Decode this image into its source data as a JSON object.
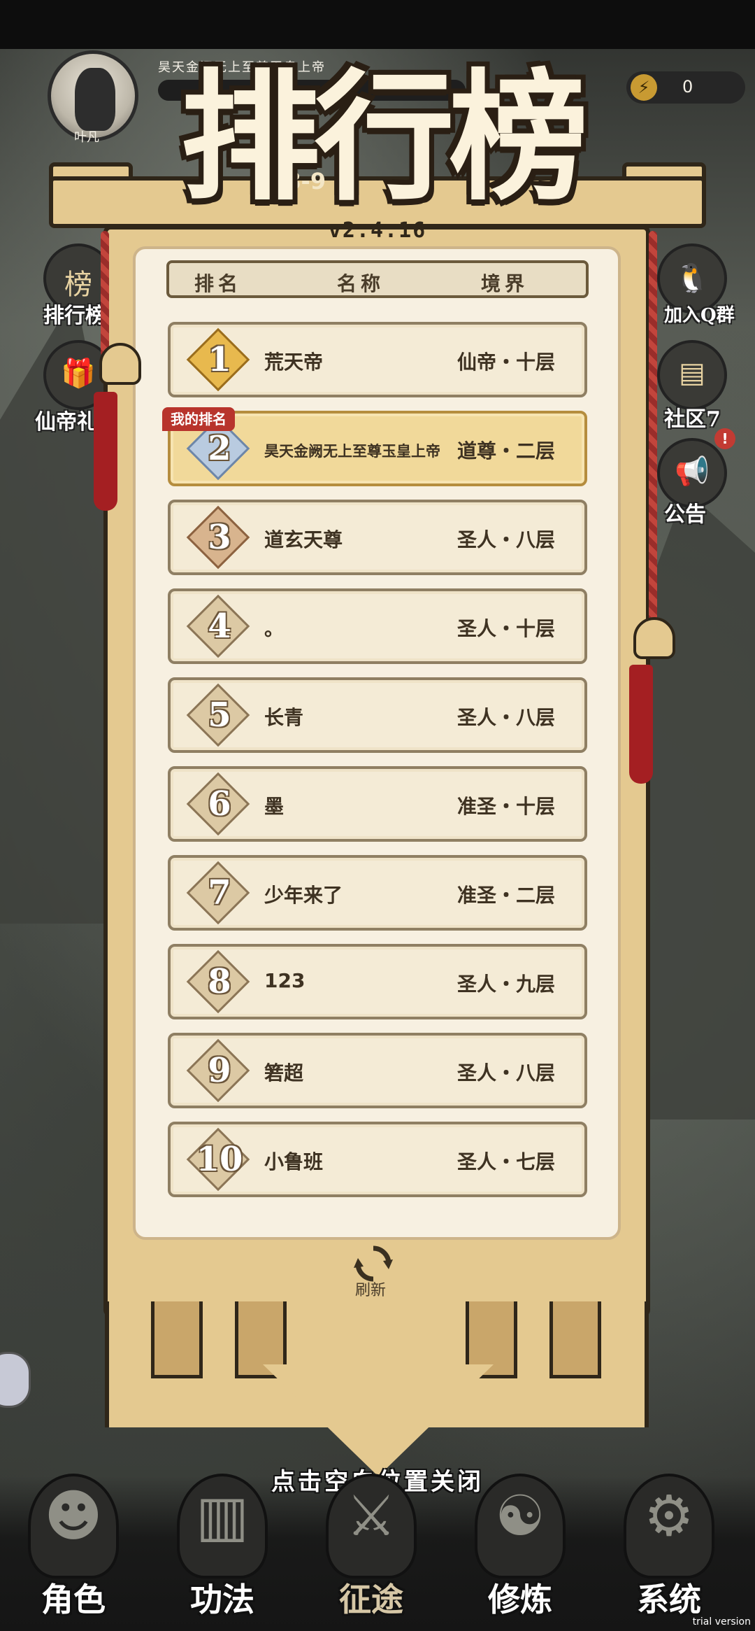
{
  "player": {
    "name": "叶凡",
    "title": "昊天金阙无上至尊玉皇上帝",
    "energy": "0"
  },
  "season": "18-9",
  "leaderboard": {
    "title": "排行榜",
    "version": "v2.4.16",
    "headers": {
      "rank": "排名",
      "name": "名称",
      "realm": "境界"
    },
    "my_rank_tag": "我的排名",
    "rows": [
      {
        "rank": "1",
        "name": "荒天帝",
        "realm": "仙帝・十层",
        "tier": "gold"
      },
      {
        "rank": "2",
        "name": "昊天金阙无上至尊玉皇上帝",
        "realm": "道尊・二层",
        "tier": "silver",
        "is_me": true
      },
      {
        "rank": "3",
        "name": "道玄天尊",
        "realm": "圣人・八层",
        "tier": "bronze"
      },
      {
        "rank": "4",
        "name": "。",
        "realm": "圣人・十层",
        "tier": "normal"
      },
      {
        "rank": "5",
        "name": "长青",
        "realm": "圣人・八层",
        "tier": "normal"
      },
      {
        "rank": "6",
        "name": "墨",
        "realm": "准圣・十层",
        "tier": "normal"
      },
      {
        "rank": "7",
        "name": "少年来了",
        "realm": "准圣・二层",
        "tier": "normal"
      },
      {
        "rank": "8",
        "name": "123",
        "realm": "圣人・九层",
        "tier": "normal"
      },
      {
        "rank": "9",
        "name": "箬超",
        "realm": "圣人・八层",
        "tier": "normal"
      },
      {
        "rank": "10",
        "name": "小鲁班",
        "realm": "圣人・七层",
        "tier": "normal"
      }
    ],
    "refresh_label": "刷新",
    "close_hint": "点击空白位置关闭"
  },
  "side_left": [
    {
      "label": "排行榜",
      "icon": "ranking-icon"
    },
    {
      "label": "仙帝礼",
      "icon": "gift-icon"
    }
  ],
  "side_right": [
    {
      "label": "加入Q群",
      "icon": "qq-penguin-icon"
    },
    {
      "label": "社区7",
      "icon": "chat-icon"
    },
    {
      "label": "公告",
      "icon": "speaker-icon"
    }
  ],
  "bottom_nav": [
    {
      "label": "角色",
      "icon": "character-icon"
    },
    {
      "label": "功法",
      "icon": "book-icon"
    },
    {
      "label": "征途",
      "icon": "sword-icon",
      "active": true
    },
    {
      "label": "修炼",
      "icon": "meditate-icon"
    },
    {
      "label": "系统",
      "icon": "system-icon"
    }
  ],
  "watermark": "trial version",
  "colors": {
    "banner": "#e4c990",
    "outline": "#2f2619",
    "my_row": "#f1d99a",
    "tag_red": "#b8342c",
    "tassel_red": "#a41f22"
  }
}
